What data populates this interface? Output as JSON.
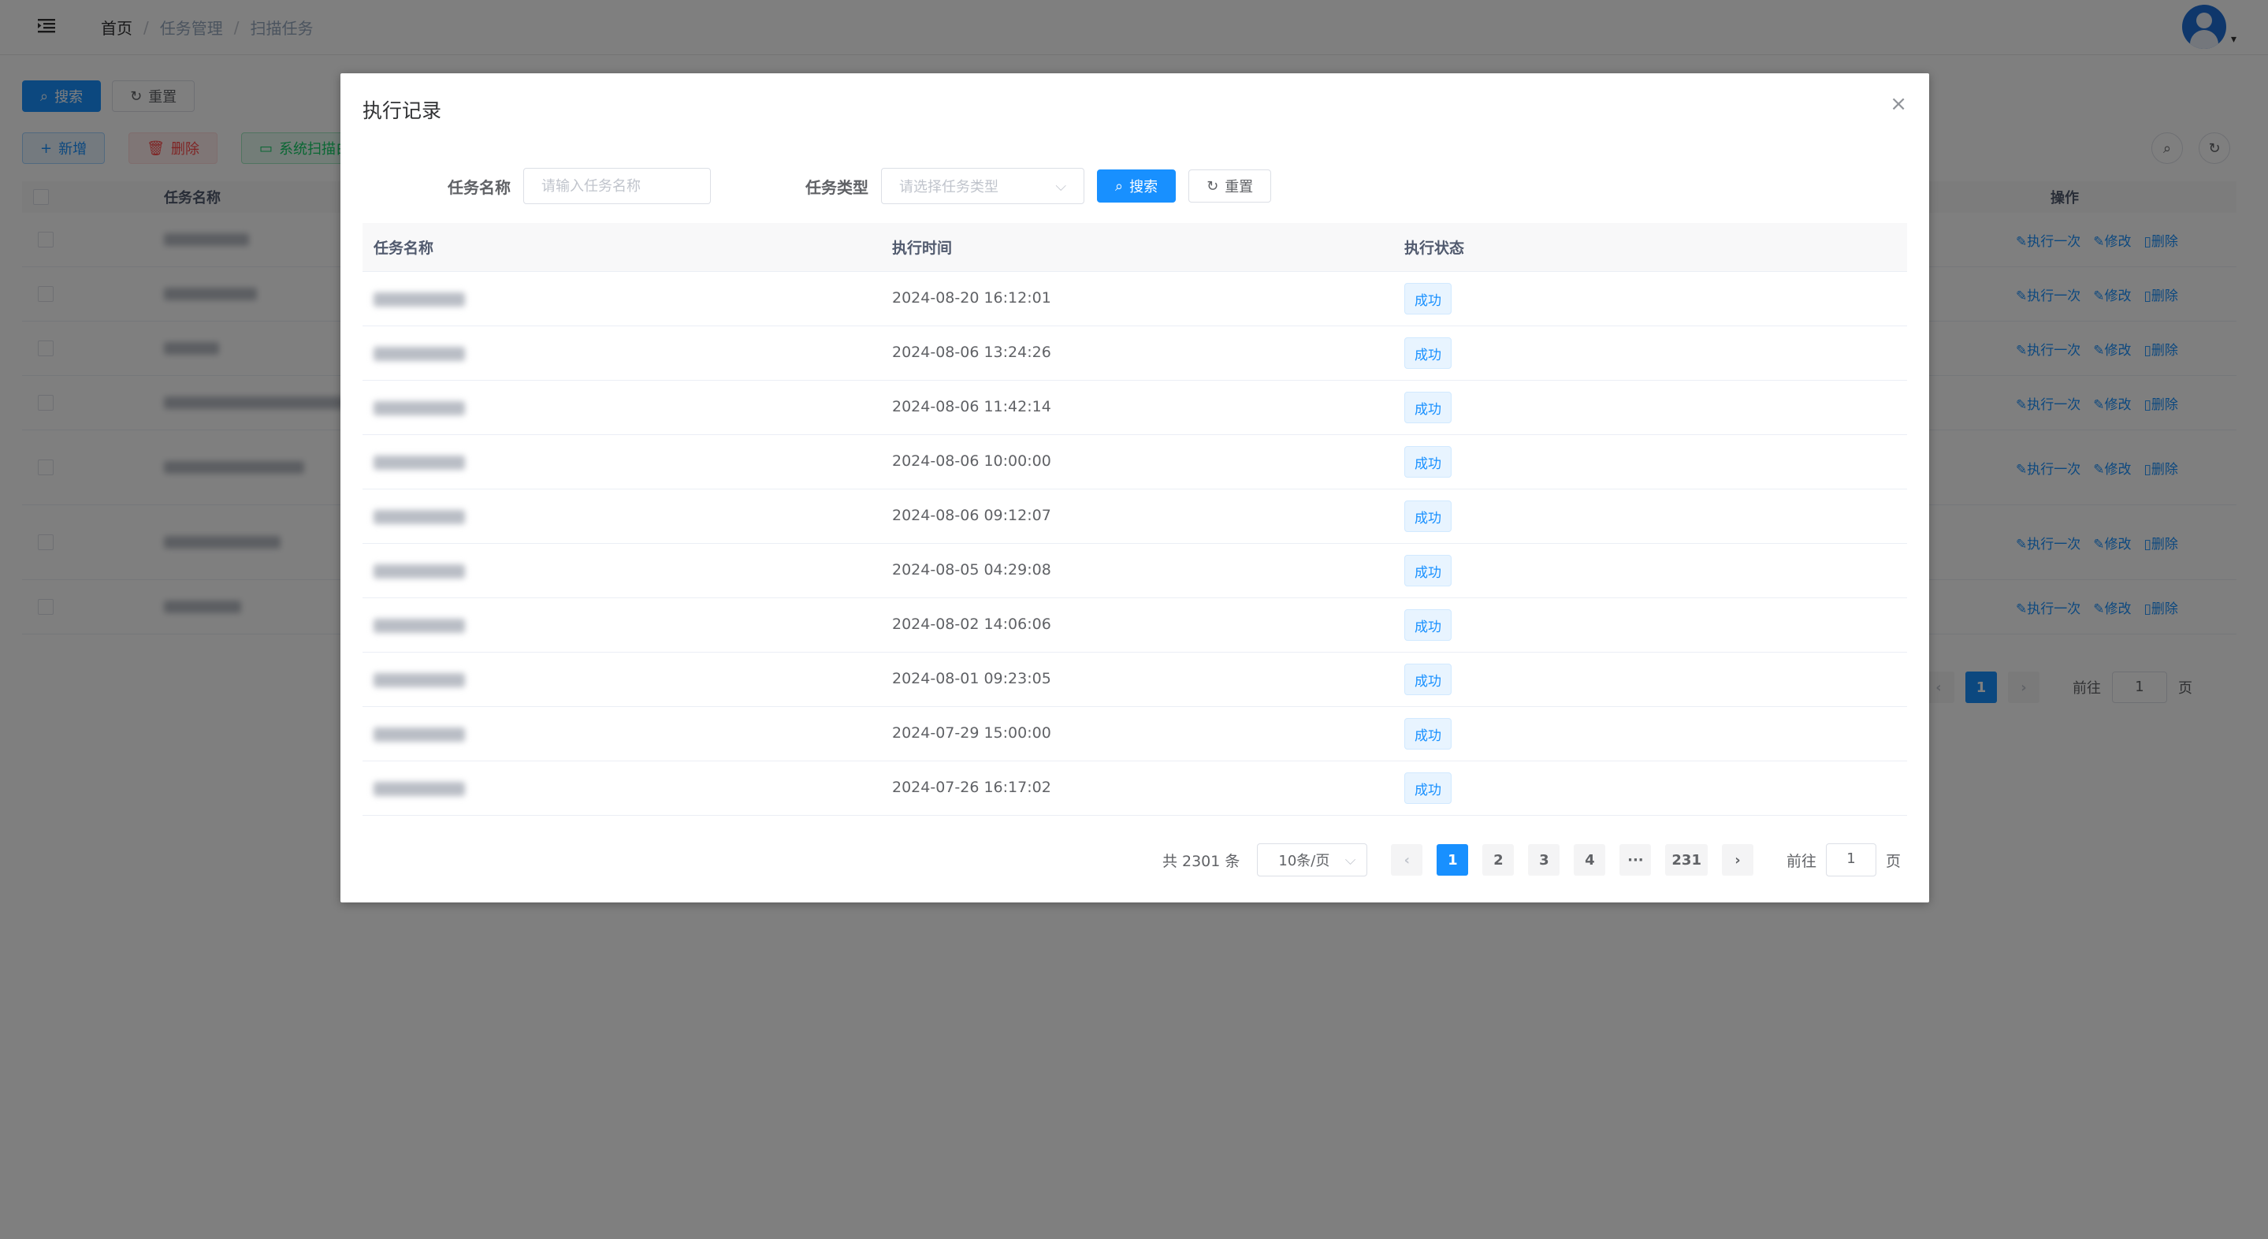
{
  "header": {
    "breadcrumb": [
      "首页",
      "任务管理",
      "扫描任务"
    ],
    "separator": "/"
  },
  "background": {
    "search_label": "搜索",
    "reset_label": "重置",
    "add_label": "新增",
    "delete_label": "删除",
    "scan_label": "系统扫描白",
    "col_name": "任务名称",
    "col_ops": "操作",
    "op_run_once": "执行一次",
    "op_edit": "修改",
    "op_delete": "删除",
    "pager": {
      "current": "1",
      "goto_label": "前往",
      "goto_value": "1",
      "page_suffix": "页"
    }
  },
  "dialog": {
    "title": "执行记录",
    "close_icon": "×",
    "filters": {
      "name_label": "任务名称",
      "name_placeholder": "请输入任务名称",
      "type_label": "任务类型",
      "type_placeholder": "请选择任务类型",
      "search_label": "搜索",
      "reset_label": "重置"
    },
    "table": {
      "headers": [
        "任务名称",
        "执行时间",
        "执行状态"
      ],
      "rows": [
        {
          "time": "2024-08-20 16:12:01",
          "status": "成功"
        },
        {
          "time": "2024-08-06 13:24:26",
          "status": "成功"
        },
        {
          "time": "2024-08-06 11:42:14",
          "status": "成功"
        },
        {
          "time": "2024-08-06 10:00:00",
          "status": "成功"
        },
        {
          "time": "2024-08-06 09:12:07",
          "status": "成功"
        },
        {
          "time": "2024-08-05 04:29:08",
          "status": "成功"
        },
        {
          "time": "2024-08-02 14:06:06",
          "status": "成功"
        },
        {
          "time": "2024-08-01 09:23:05",
          "status": "成功"
        },
        {
          "time": "2024-07-29 15:00:00",
          "status": "成功"
        },
        {
          "time": "2024-07-26 16:17:02",
          "status": "成功"
        }
      ]
    },
    "pagination": {
      "total": "共 2301 条",
      "page_size": "10条/页",
      "pages": [
        "1",
        "2",
        "3",
        "4",
        "···",
        "231"
      ],
      "current": "1",
      "goto_label": "前往",
      "goto_value": "1",
      "page_suffix": "页"
    }
  },
  "colors": {
    "primary": "#1890ff",
    "mask": "rgba(0,0,0,0.5)",
    "success_tag_bg": "#e8f4ff"
  }
}
